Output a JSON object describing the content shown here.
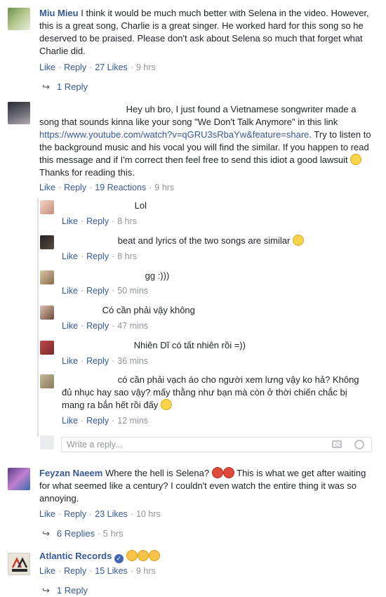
{
  "comments": [
    {
      "name": "Miu Mieu",
      "text": "I think it would be much much better with Selena in the video. However, this is a great song, Charlie is a great singer. He worked hard for this song so he deserved to be praised. Please don't ask about Selena so much that forget what Charlie did.",
      "actions": {
        "like": "Like",
        "reply": "Reply",
        "count": "27 Likes",
        "time": "9 hrs"
      },
      "replies_label": "1 Reply"
    },
    {
      "text_1": "Hey uh bro, I just found a Vietnamese songwriter made a song that sounds kinna like your song \"We Don't Talk Anymore\" in this link",
      "link": "https://www.youtube.com/watch?v=qGRU3sRbaYw&feature=share",
      "text_2": ". Try to listen to the background music and his vocal you will find the similar. If you happen to read this message and if I'm correct then feel free to send this idiot a good lawsuit",
      "text_3": "Thanks for reading this.",
      "actions": {
        "like": "Like",
        "reply": "Reply",
        "count": "19 Reactions",
        "time": "9 hrs"
      }
    },
    {
      "name": "Feyzan Naeem",
      "text_1": "Where the hell is Selena?",
      "text_2": "This is what we get after waiting for what seemed like a century? I couldn't even watch the entire thing it was so annoying.",
      "actions": {
        "like": "Like",
        "reply": "Reply",
        "count": "23 Likes",
        "time": "10 hrs"
      },
      "replies_label": "6 Replies",
      "replies_time": "5 hrs"
    },
    {
      "name": "Atlantic Records",
      "actions": {
        "like": "Like",
        "reply": "Reply",
        "count": "15 Likes",
        "time": "9 hrs"
      },
      "replies_label": "1 Reply"
    }
  ],
  "replies": [
    {
      "text": "Lol",
      "actions": {
        "like": "Like",
        "reply": "Reply",
        "time": "8 hrs"
      }
    },
    {
      "text": "beat and lyrics of the two songs are similar",
      "actions": {
        "like": "Like",
        "reply": "Reply",
        "time": "8 hrs"
      }
    },
    {
      "text": "gg :)))",
      "actions": {
        "like": "Like",
        "reply": "Reply",
        "time": "50 mins"
      }
    },
    {
      "text": "Có cần phải vậy không",
      "actions": {
        "like": "Like",
        "reply": "Reply",
        "time": "47 mins"
      }
    },
    {
      "text": "Nhiên Dĩ có tất nhiên rồi =))",
      "actions": {
        "like": "Like",
        "reply": "Reply",
        "time": "36 mins"
      }
    },
    {
      "text": "có cần phải vạch áo cho người xem lưng vậy ko hả? Không đủ nhục hay sao vậy? mấy thằng như bạn mà còn ở thời chiến chắc bị mang ra bắn hết rồi đấy",
      "actions": {
        "like": "Like",
        "reply": "Reply",
        "time": "12 mins"
      }
    }
  ],
  "reply_input": {
    "placeholder": "Write a reply..."
  },
  "icons": {
    "reply_arrow": "reply-arrow-icon",
    "camera": "camera-icon",
    "emoji": "emoji-icon",
    "verified": "verified-badge-icon"
  }
}
